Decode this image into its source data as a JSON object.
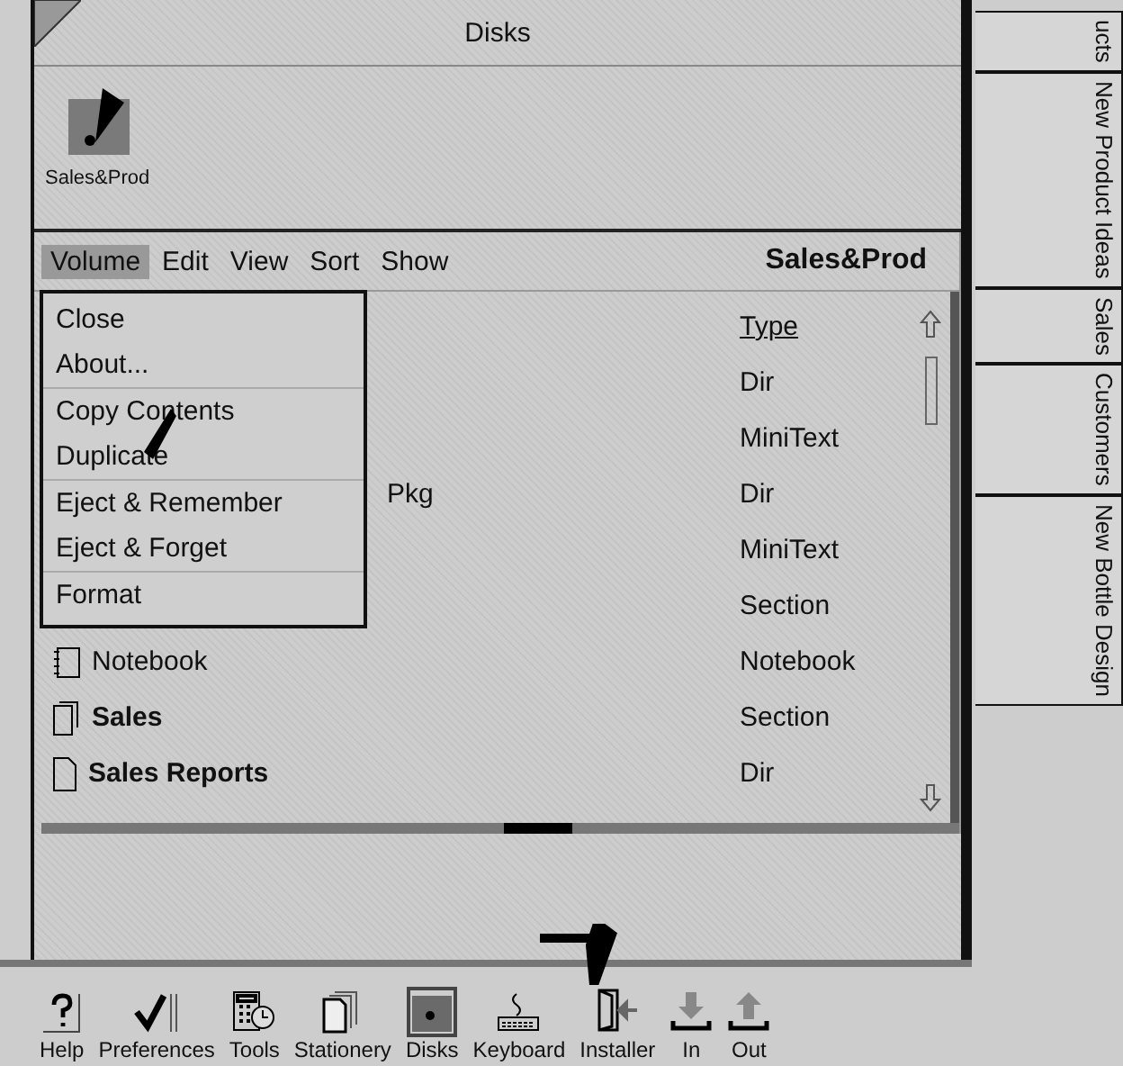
{
  "window": {
    "title": "Disks"
  },
  "disk_icons": [
    {
      "label": "Sales&Prod"
    }
  ],
  "browser": {
    "menus": [
      {
        "label": "Volume",
        "selected": true
      },
      {
        "label": "Edit",
        "selected": false
      },
      {
        "label": "View",
        "selected": false
      },
      {
        "label": "Sort",
        "selected": false
      },
      {
        "label": "Show",
        "selected": false
      }
    ],
    "title": "Sales&Prod",
    "column_header": "Type",
    "rows": [
      {
        "type": "Dir"
      },
      {
        "type": "MiniText"
      },
      {
        "name": "Pkg",
        "type": "Dir",
        "covered": true
      },
      {
        "type": "MiniText"
      },
      {
        "type": "Section"
      },
      {
        "name": "Notebook",
        "type": "Notebook",
        "kind": "notebook",
        "bold": false
      },
      {
        "name": "Sales",
        "type": "Section",
        "kind": "section",
        "bold": true
      },
      {
        "name": "Sales Reports",
        "type": "Dir",
        "kind": "document",
        "bold": true
      }
    ],
    "dropdown": [
      {
        "label": "Close",
        "separator_before": false
      },
      {
        "label": "About...",
        "separator_before": false
      },
      {
        "label": "Copy Contents",
        "separator_before": true
      },
      {
        "label": "Duplicate",
        "separator_before": false
      },
      {
        "label": "Eject & Remember",
        "separator_before": true
      },
      {
        "label": "Eject & Forget",
        "separator_before": false
      },
      {
        "label": "Format",
        "separator_before": true
      }
    ]
  },
  "side_tabs": [
    {
      "label": "ucts"
    },
    {
      "label": "New Product Ideas"
    },
    {
      "label": "Sales"
    },
    {
      "label": "Customers"
    },
    {
      "label": "New Bottle Design"
    }
  ],
  "toolbar": [
    {
      "label": "Help",
      "kind": "help",
      "selected": false
    },
    {
      "label": "Preferences",
      "kind": "check",
      "selected": false
    },
    {
      "label": "Tools",
      "kind": "tools",
      "selected": false
    },
    {
      "label": "Stationery",
      "kind": "stationery",
      "selected": false
    },
    {
      "label": "Disks",
      "kind": "disk",
      "selected": true
    },
    {
      "label": "Keyboard",
      "kind": "keyboard",
      "selected": false
    },
    {
      "label": "Installer",
      "kind": "installer",
      "selected": false
    },
    {
      "label": "In",
      "kind": "in",
      "selected": false
    },
    {
      "label": "Out",
      "kind": "out",
      "selected": false
    }
  ]
}
